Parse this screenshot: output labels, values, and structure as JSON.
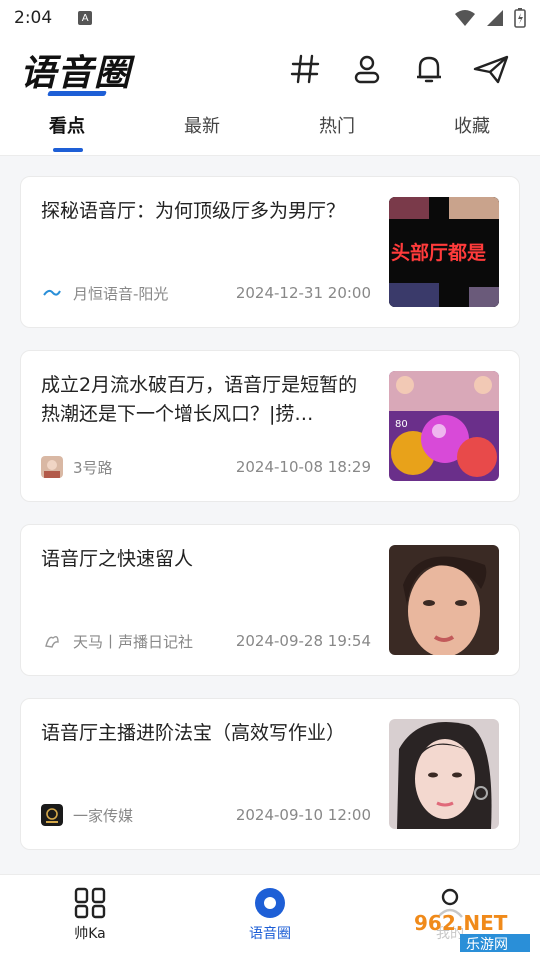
{
  "status_bar": {
    "time": "2:04",
    "a_label": "A"
  },
  "header": {
    "logo": "语音圈",
    "icons": [
      "hash-icon",
      "user-icon",
      "bell-icon",
      "send-icon"
    ]
  },
  "tabs": [
    {
      "label": "看点",
      "active": true
    },
    {
      "label": "最新",
      "active": false
    },
    {
      "label": "热门",
      "active": false
    },
    {
      "label": "收藏",
      "active": false
    }
  ],
  "articles": [
    {
      "title": "探秘语音厅：为何顶级厅多为男厅？",
      "source": "月恒语音-阳光",
      "time": "2024-12-31 20:00",
      "thumb_text": "头部厅都是"
    },
    {
      "title": "成立2月流水破百万，语音厅是短暂的热潮还是下一个增长风口？|捞…",
      "source": "3号路",
      "time": "2024-10-08 18:29",
      "thumb_text": "80"
    },
    {
      "title": "语音厅之快速留人",
      "source": "天马丨声播日记社",
      "time": "2024-09-28 19:54",
      "thumb_text": ""
    },
    {
      "title": "语音厅主播进阶法宝（高效写作业）",
      "source": "一家传媒",
      "time": "2024-09-10 12:00",
      "thumb_text": ""
    }
  ],
  "bottom_nav": [
    {
      "label": "帅Ka",
      "active": false
    },
    {
      "label": "语音圈",
      "active": true
    },
    {
      "label": "我的",
      "active": false
    }
  ],
  "watermark": {
    "top": "962.NET",
    "bottom": "乐游网"
  },
  "colors": {
    "accent": "#1e5fd6"
  }
}
